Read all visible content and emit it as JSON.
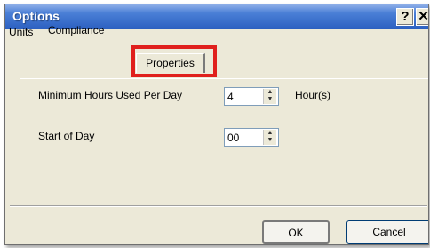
{
  "window": {
    "title": "Options",
    "help_label": "?",
    "close_label": "✕"
  },
  "tabs": [
    {
      "label": "Units"
    },
    {
      "label": "Compliance"
    },
    {
      "label": "Properties"
    }
  ],
  "form": {
    "min_hours_label": "Minimum Hours Used Per Day",
    "min_hours_value": "4",
    "min_hours_unit": "Hour(s)",
    "start_of_day_label": "Start of Day",
    "start_of_day_value": "00"
  },
  "buttons": {
    "ok": "OK",
    "cancel": "Cancel"
  },
  "colors": {
    "highlight": "#e0201d",
    "titlebar": "#2b5fc0",
    "dialog_bg": "#ece9d8"
  }
}
